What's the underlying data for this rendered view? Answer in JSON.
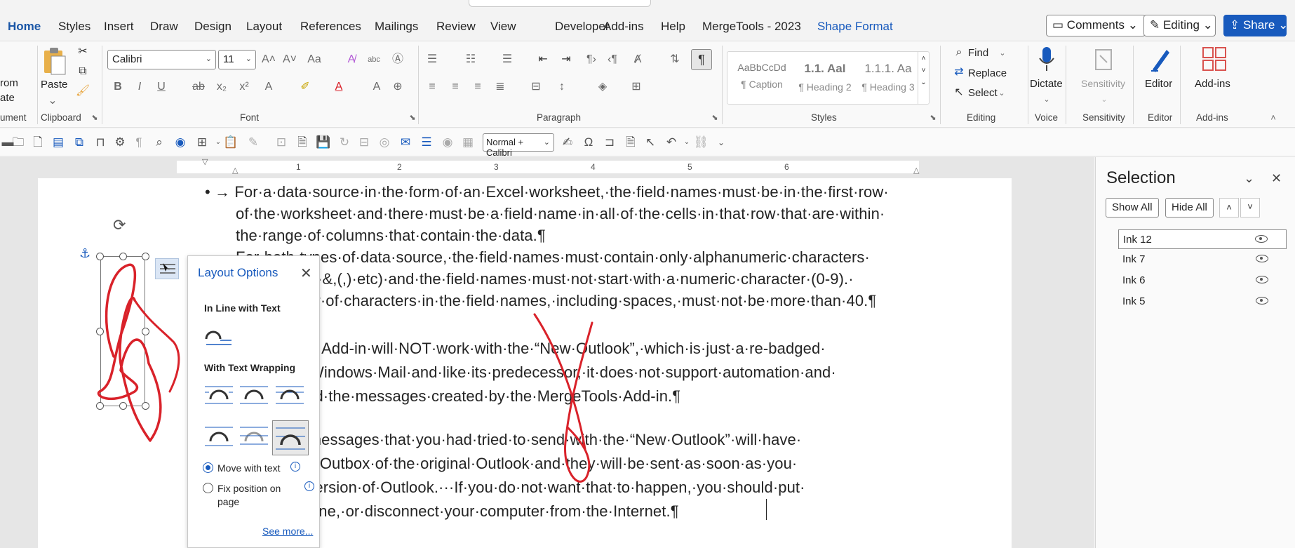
{
  "tabs": [
    "Home",
    "Styles",
    "Insert",
    "Draw",
    "Design",
    "Layout",
    "References",
    "Mailings",
    "Review",
    "View",
    "Developer",
    "Add-ins",
    "Help",
    "MergeTools - 2023",
    "Shape Format"
  ],
  "top_buttons": {
    "comments": "Comments",
    "editing": "Editing",
    "share": "Share"
  },
  "ribbon": {
    "left_cut_1": "rom",
    "left_cut_2": "ate",
    "left_cut_3": "ument",
    "paste": "Paste",
    "clipboard": "Clipboard",
    "font_name": "Calibri",
    "font_size": "11",
    "font_group": "Font",
    "paragraph_group": "Paragraph",
    "styles": [
      {
        "sample": "AaBbCcDd",
        "name": "¶ Caption"
      },
      {
        "sample": "1.1.  AaI",
        "name": "¶ Heading 2"
      },
      {
        "sample": "1.1.1.  Aa",
        "name": "¶ Heading 3"
      }
    ],
    "styles_group": "Styles",
    "find": "Find",
    "replace": "Replace",
    "select": "Select",
    "editing_group": "Editing",
    "dictate": "Dictate",
    "voice_group": "Voice",
    "sensitivity": "Sensitivity",
    "sensitivity_group": "Sensitivity",
    "editor": "Editor",
    "editor_group": "Editor",
    "addins": "Add-ins",
    "addins_group": "Add-ins"
  },
  "qat": {
    "style_combo": "Normal + Calibri"
  },
  "ruler_numbers": [
    "1",
    "2",
    "3",
    "4",
    "5",
    "6"
  ],
  "document": {
    "lines": [
      "•  →  For·a·data·source·in·the·form·of·an·Excel·worksheet,·the·field·names·must·be·in·the·first·row·",
      "of·the·worksheet·and·there·must·be·a·field·name·in·all·of·the·cells·in·that·row·that·are·within·",
      "the·range·of·columns·that·contain·the·data.¶",
      "For·both·types·of·data·source,·the·field·names·must·contain·only·alphanumeric·characters·",
      "(no·spaces,·&,(,)·etc)·and·the·field·names·must·not·start·with·a·numeric·character·(0-9).·",
      "The·number·of·characters·in·the·field·names,·including·spaces,·must·not·be·more·than·40.¶",
      "MergeTools·Add-in·will·NOT·work·with·the·“New·Outlook”,·which·is·just·a·re-badged·",
      "version·of·Windows·Mail·and·like·its·predecessor,·it·does·not·support·automation·and·",
      "will·not·send·the·messages·created·by·the·MergeTools·Add-in.¶",
      "Note:·any·messages·that·you·had·tried·to·send·with·the·“New·Outlook”·will·have·",
      "been·in·the·Outbox·of·the·original·Outlook·and·they·will·be·sent·as·soon·as·you·",
      "open·that·version·of·Outlook.···If·you·do·not·want·that·to·happen,·you·should·put·",
      "Outlook·offline,·or·disconnect·your·computer·from·the·Internet.¶"
    ]
  },
  "layout_options": {
    "title": "Layout Options",
    "inline_heading": "In Line with Text",
    "wrap_heading": "With Text Wrapping",
    "move_with_text": "Move with text",
    "fix_position": "Fix position on page",
    "see_more": "See more...",
    "selected_option": "move_with_text"
  },
  "selection_pane": {
    "title": "Selection",
    "show_all": "Show All",
    "hide_all": "Hide All",
    "items": [
      "Ink 12",
      "Ink 7",
      "Ink 6",
      "Ink 5"
    ],
    "selected": "Ink 12"
  },
  "colors": {
    "accent": "#185abd",
    "ink": "#d9222a"
  }
}
